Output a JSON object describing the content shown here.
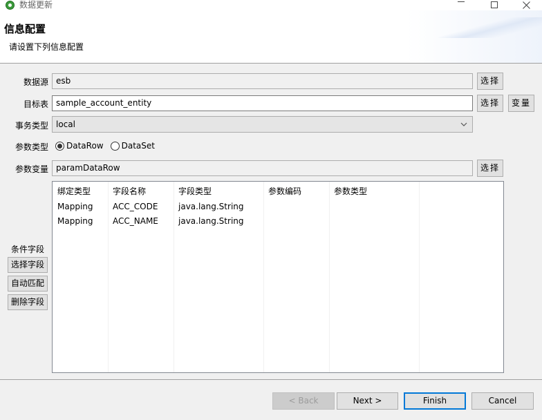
{
  "window": {
    "title": "数据更新",
    "icon": "app-icon"
  },
  "banner": {
    "title": "信息配置",
    "subtitle": "请设置下列信息配置"
  },
  "form": {
    "datasource": {
      "label": "数据源",
      "value": "esb",
      "button": "选择"
    },
    "target_table": {
      "label": "目标表",
      "value": "sample_account_entity",
      "button": "选择",
      "var_button": "变量"
    },
    "transaction_type": {
      "label": "事务类型",
      "value": "local"
    },
    "param_type": {
      "label": "参数类型",
      "options": [
        "DataRow",
        "DataSet"
      ],
      "selected": "DataRow"
    },
    "param_var": {
      "label": "参数变量",
      "value": "paramDataRow",
      "button": "选择"
    }
  },
  "conditions": {
    "label": "条件字段",
    "buttons": [
      "选择字段",
      "自动匹配",
      "删除字段"
    ]
  },
  "table": {
    "columns": [
      "绑定类型",
      "字段名称",
      "字段类型",
      "参数编码",
      "参数类型"
    ],
    "rows": [
      [
        "Mapping",
        "ACC_CODE",
        "java.lang.String",
        "",
        ""
      ],
      [
        "Mapping",
        "ACC_NAME",
        "java.lang.String",
        "",
        ""
      ]
    ]
  },
  "footer": {
    "back": "< Back",
    "next": "Next >",
    "finish": "Finish",
    "cancel": "Cancel"
  },
  "colors": {
    "accent": "#0078d7",
    "app_icon": "#3c9a3c"
  }
}
